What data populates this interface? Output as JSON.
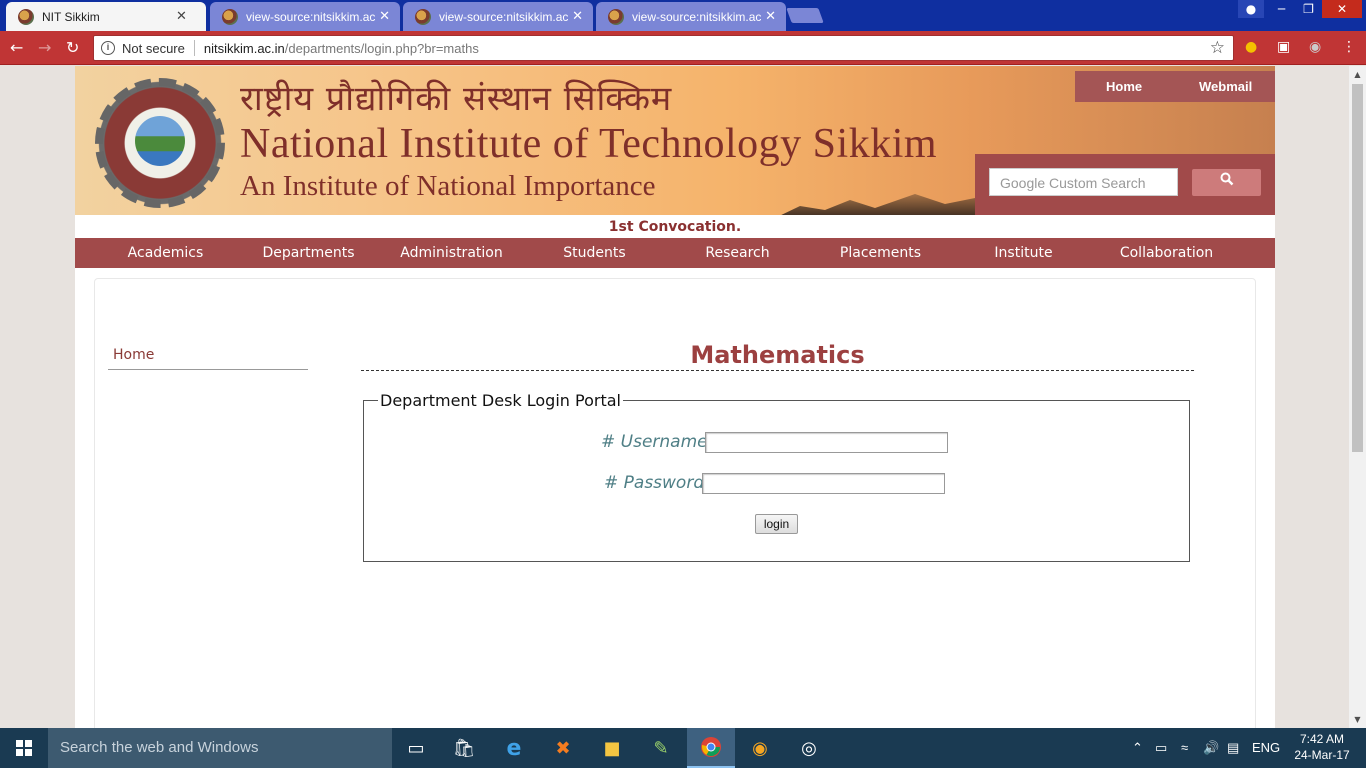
{
  "browser": {
    "tabs": [
      {
        "title": "NIT Sikkim",
        "active": true
      },
      {
        "title": "view-source:nitsikkim.ac.in",
        "active": false
      },
      {
        "title": "view-source:nitsikkim.ac.in",
        "active": false
      },
      {
        "title": "view-source:nitsikkim.ac.in",
        "active": false
      }
    ],
    "close_glyph": "✕",
    "security_label": "Not secure",
    "url_host": "nitsikkim.ac.in",
    "url_path": "/departments/login.php?br=maths",
    "icons": {
      "back": "arrow-left-icon",
      "forward": "arrow-right-icon",
      "reload": "reload-icon",
      "info": "info-icon",
      "bookmark": "star-icon",
      "menu": "kebab-menu-icon"
    },
    "theme_color": "#c03535"
  },
  "site": {
    "hindi_name": "राष्ट्रीय प्रौद्योगिकी संस्थान सिक्किम",
    "name": "National Institute of Technology Sikkim",
    "tagline": "An Institute of National Importance",
    "top_links": {
      "home": "Home",
      "webmail": "Webmail"
    },
    "search_placeholder": "Google Custom Search",
    "ticker": "1st Convocation.",
    "nav": [
      "Academics",
      "Departments",
      "Administration",
      "Students",
      "Research",
      "Placements",
      "Institute",
      "Collaboration"
    ],
    "brand_color": "#a14a4a"
  },
  "department": {
    "sidebar_home": "Home",
    "title": "Mathematics",
    "login": {
      "legend": "Department Desk Login Portal",
      "username_label": "# Username",
      "password_label": "# Password",
      "username_value": "",
      "password_value": "",
      "button": "login"
    }
  },
  "taskbar": {
    "search_placeholder": "Search the web and Windows",
    "language": "ENG",
    "time": "7:42 AM",
    "date": "24-Mar-17",
    "pinned_icons": [
      "task-view-icon",
      "store-icon",
      "edge-icon",
      "xampp-icon",
      "file-explorer-icon",
      "notepad-icon",
      "chrome-icon",
      "uc-browser-icon",
      "groove-icon"
    ]
  }
}
